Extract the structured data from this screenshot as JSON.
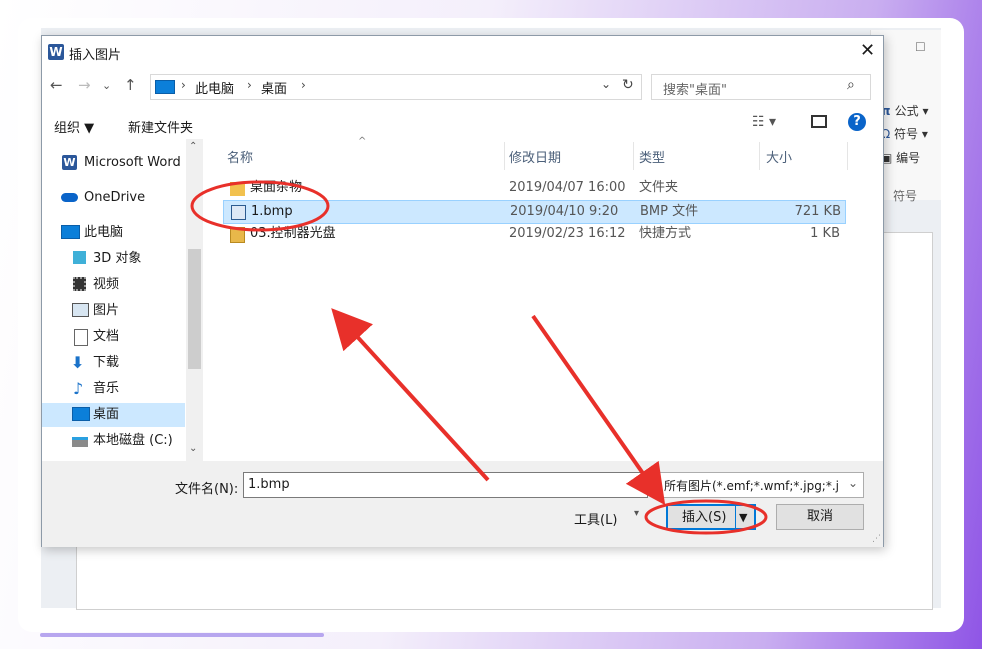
{
  "ribbon": {
    "formula": "公式",
    "symbol": "符号",
    "number": "编号",
    "group_label": "符号"
  },
  "dialog": {
    "title": "插入图片",
    "app_icon_letter": "W",
    "breadcrumb": [
      "此电脑",
      "桌面"
    ],
    "search_placeholder": "搜索\"桌面\"",
    "toolbar": {
      "organize": "组织 ▼",
      "new_folder": "新建文件夹"
    },
    "nav_items": [
      {
        "label": "Microsoft Word",
        "icon": "word-icon"
      },
      {
        "label": "OneDrive",
        "icon": "cloud-icon"
      },
      {
        "label": "此电脑",
        "icon": "computer-icon"
      },
      {
        "label": "3D 对象",
        "icon": "cube-icon"
      },
      {
        "label": "视频",
        "icon": "video-icon"
      },
      {
        "label": "图片",
        "icon": "picture-icon"
      },
      {
        "label": "文档",
        "icon": "document-icon"
      },
      {
        "label": "下载",
        "icon": "download-icon"
      },
      {
        "label": "音乐",
        "icon": "music-icon"
      },
      {
        "label": "桌面",
        "icon": "desktop-icon"
      },
      {
        "label": "本地磁盘 (C:)",
        "icon": "disk-icon"
      }
    ],
    "columns": {
      "name": "名称",
      "date": "修改日期",
      "type": "类型",
      "size": "大小"
    },
    "files": [
      {
        "name": "桌面杂物",
        "date": "2019/04/07 16:00",
        "type": "文件夹",
        "size": ""
      },
      {
        "name": "1.bmp",
        "date": "2019/04/10 9:20",
        "type": "BMP 文件",
        "size": "721 KB"
      },
      {
        "name": "03.控制器光盘",
        "date": "2019/02/23 16:12",
        "type": "快捷方式",
        "size": "1 KB"
      }
    ],
    "filename_label": "文件名(N):",
    "filename_value": "1.bmp",
    "filter_value": "所有图片(*.emf;*.wmf;*.jpg;*.j",
    "tools_label": "工具(L)",
    "insert_label": "插入(S)",
    "cancel_label": "取消"
  },
  "colors": {
    "accent": "#0078d7",
    "selection": "#cce8ff",
    "annotation": "#e8302a"
  }
}
